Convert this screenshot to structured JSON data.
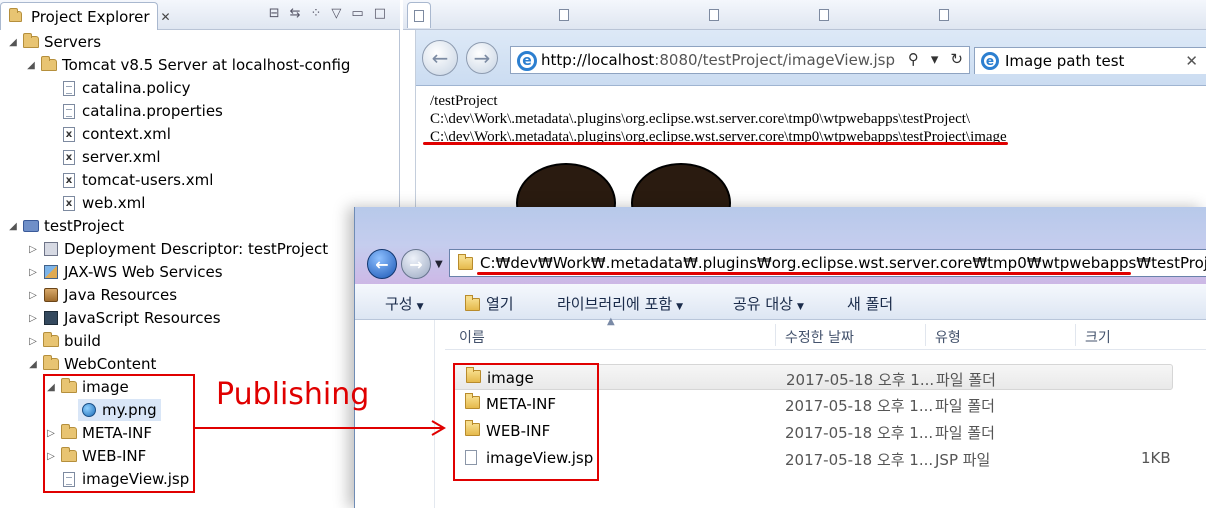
{
  "explorer": {
    "tab_title": "Project Explorer",
    "tree": [
      {
        "label": "Servers"
      },
      {
        "label": "Tomcat v8.5 Server at localhost-config"
      },
      {
        "label": "catalina.policy"
      },
      {
        "label": "catalina.properties"
      },
      {
        "label": "context.xml"
      },
      {
        "label": "server.xml"
      },
      {
        "label": "tomcat-users.xml"
      },
      {
        "label": "web.xml"
      },
      {
        "label": "testProject"
      },
      {
        "label": "Deployment Descriptor: testProject"
      },
      {
        "label": "JAX-WS Web Services"
      },
      {
        "label": "Java Resources"
      },
      {
        "label": "JavaScript Resources"
      },
      {
        "label": "build"
      },
      {
        "label": "WebContent"
      },
      {
        "label": "image"
      },
      {
        "label": "my.png"
      },
      {
        "label": "META-INF"
      },
      {
        "label": "WEB-INF"
      },
      {
        "label": "imageView.jsp"
      }
    ]
  },
  "browser": {
    "address_host": "http://localhost",
    "address_rest": ":8080/testProject/imageView.jsp",
    "page_tab_title": "Image path test",
    "page_lines": [
      "/testProject",
      "C:\\dev\\Work\\.metadata\\.plugins\\org.eclipse.wst.server.core\\tmp0\\wtpwebapps\\testProject\\",
      "C:\\dev\\Work\\.metadata\\.plugins\\org.eclipse.wst.server.core\\tmp0\\wtpwebapps\\testProject\\image"
    ]
  },
  "folder_window": {
    "address": "C:₩dev₩Work₩.metadata₩.plugins₩org.eclipse.wst.server.core₩tmp0₩wtpwebapps₩testProject",
    "toolbar": {
      "organize": "구성",
      "open": "열기",
      "include_in_library": "라이브러리에 포함",
      "share_with": "공유 대상",
      "new_folder": "새 폴더"
    },
    "columns": {
      "name": "이름",
      "date": "수정한 날짜",
      "type": "유형",
      "size": "크기"
    },
    "rows": [
      {
        "name": "image",
        "date": "2017-05-18 오후 1...",
        "type": "파일 폴더",
        "size": ""
      },
      {
        "name": "META-INF",
        "date": "2017-05-18 오후 1...",
        "type": "파일 폴더",
        "size": ""
      },
      {
        "name": "WEB-INF",
        "date": "2017-05-18 오후 1...",
        "type": "파일 폴더",
        "size": ""
      },
      {
        "name": "imageView.jsp",
        "date": "2017-05-18 오후 1...",
        "type": "JSP 파일",
        "size": "1KB"
      }
    ]
  },
  "annotation": {
    "label": "Publishing",
    "color": "#e00000"
  }
}
